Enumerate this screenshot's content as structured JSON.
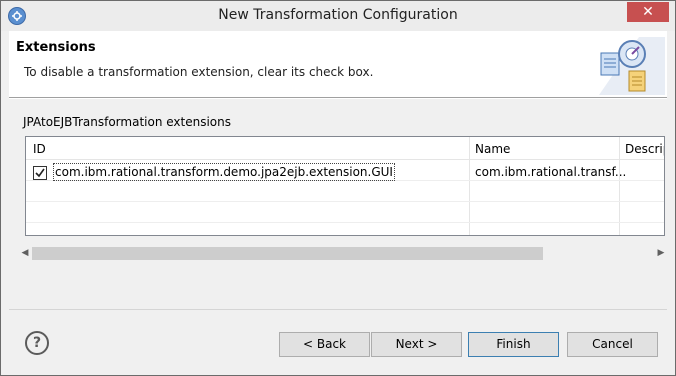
{
  "window": {
    "title": "New Transformation Configuration",
    "close_symbol": "✕",
    "app_icon": "transform-app-icon"
  },
  "header": {
    "title": "Extensions",
    "description": "To disable a transformation extension, clear its check box.",
    "art_icon": "wizard-banner-icon"
  },
  "section": {
    "label": "JPAtoEJBTransformation extensions"
  },
  "table": {
    "columns": [
      "ID",
      "Name",
      "Descrip"
    ],
    "rows": [
      {
        "checked": true,
        "id": "com.ibm.rational.transform.demo.jpa2ejb.extension.GUI",
        "name": "com.ibm.rational.transf..."
      }
    ]
  },
  "scrollbar": {
    "left_arrow": "◀",
    "right_arrow": "▶"
  },
  "footer": {
    "help_symbol": "?",
    "back_label": "< Back",
    "next_label": "Next >",
    "finish_label": "Finish",
    "cancel_label": "Cancel"
  },
  "colors": {
    "close_button": "#c75050",
    "default_button_border": "#3c7fb1",
    "scroll_thumb": "#cdcdcd"
  }
}
